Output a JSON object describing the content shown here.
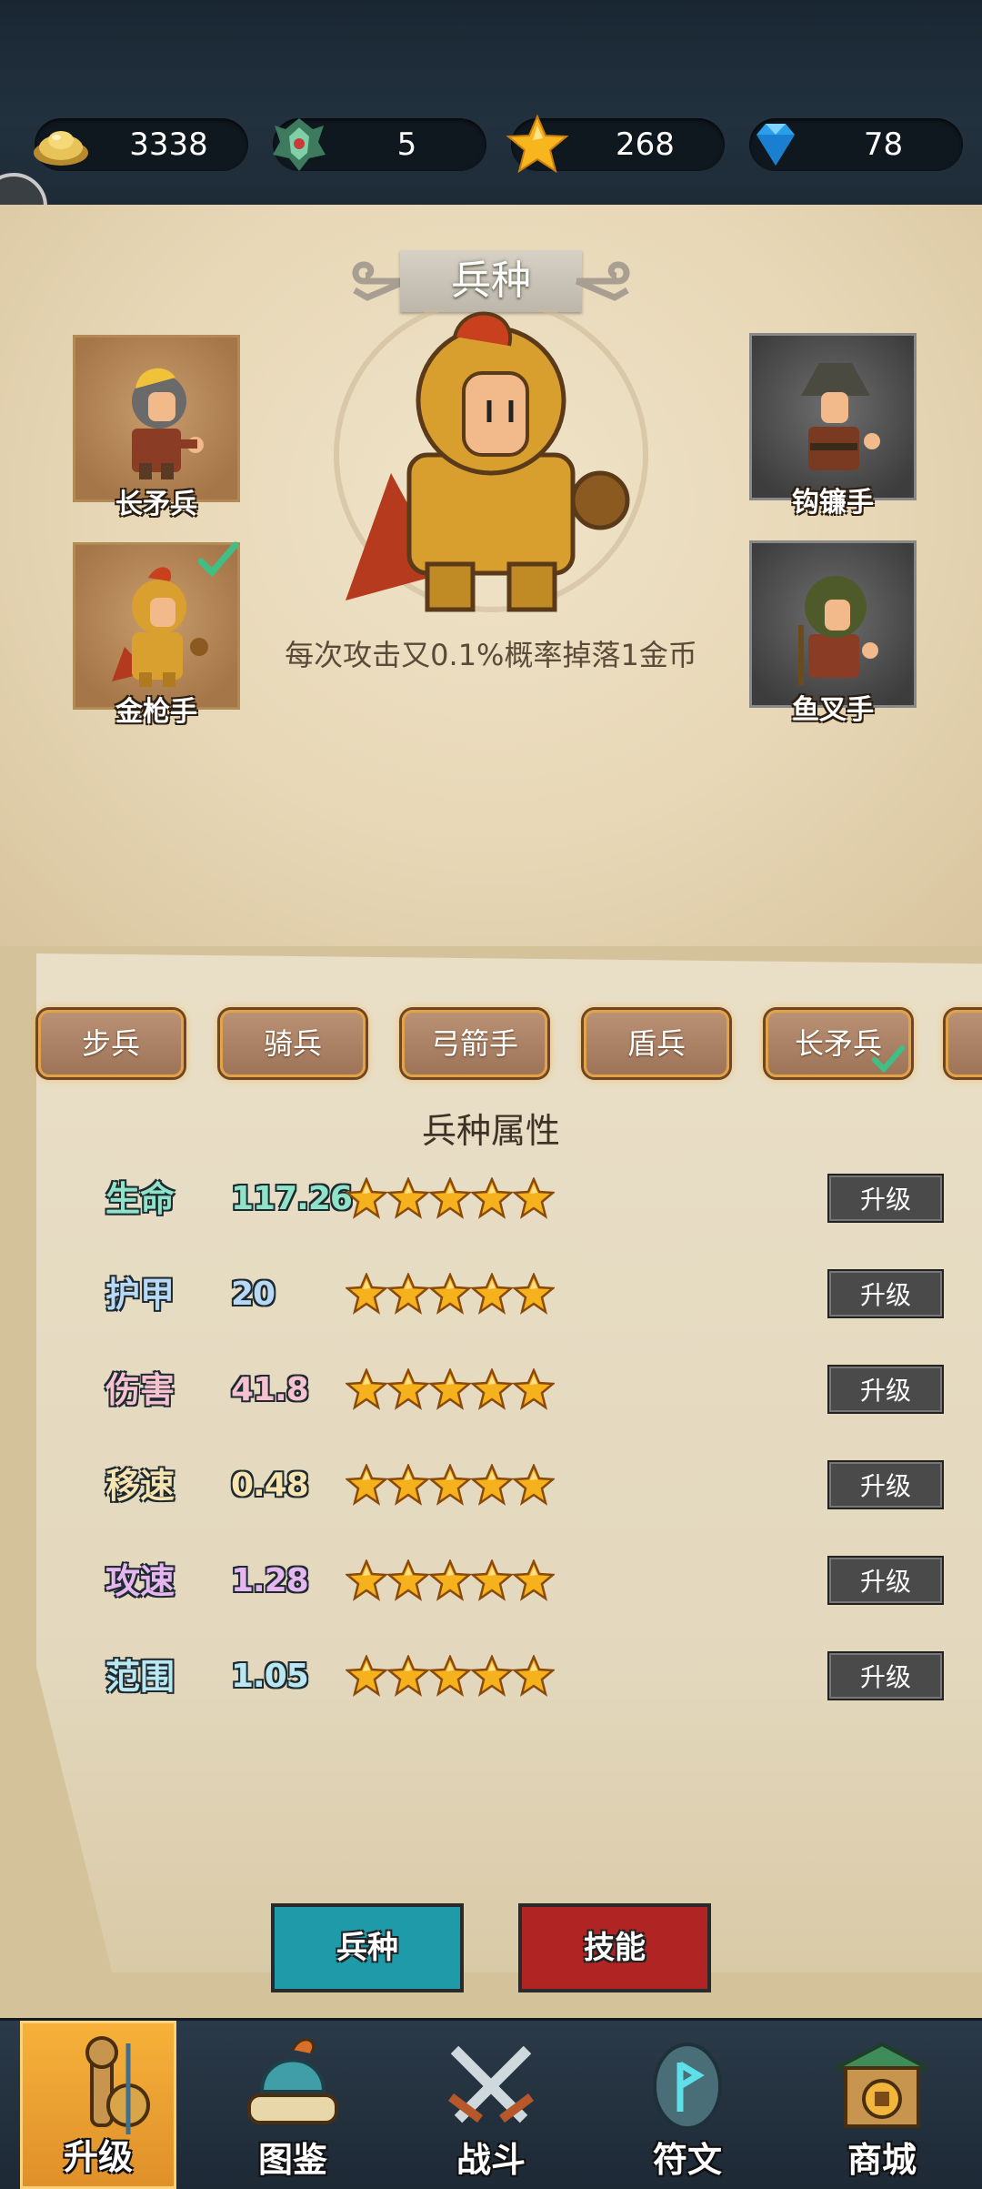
{
  "resources": [
    {
      "icon": "gold-ingot-icon",
      "value": "3338"
    },
    {
      "icon": "dragon-emblem-icon",
      "value": "5"
    },
    {
      "icon": "star-icon",
      "value": "268"
    },
    {
      "icon": "diamond-icon",
      "value": "78"
    }
  ],
  "title": "兵种",
  "units_left": [
    {
      "label": "长矛兵",
      "selected": false
    },
    {
      "label": "金枪手",
      "selected": true
    }
  ],
  "units_right": [
    {
      "label": "钩镰手",
      "locked": true
    },
    {
      "label": "鱼叉手",
      "locked": true
    }
  ],
  "hero_description": "每次攻击又0.1%概率掉落1金币",
  "tabs": [
    {
      "label": "步兵"
    },
    {
      "label": "骑兵"
    },
    {
      "label": "弓箭手"
    },
    {
      "label": "盾兵"
    },
    {
      "label": "长矛兵",
      "selected": true
    }
  ],
  "section_title": "兵种属性",
  "attributes": [
    {
      "name": "生命",
      "value": "117.26",
      "stars": 5,
      "button": "升级",
      "color": "#8fe3c8"
    },
    {
      "name": "护甲",
      "value": "20",
      "stars": 5,
      "button": "升级",
      "color": "#b8d9f5"
    },
    {
      "name": "伤害",
      "value": "41.8",
      "stars": 5,
      "button": "升级",
      "color": "#f7c2cf"
    },
    {
      "name": "移速",
      "value": "0.48",
      "stars": 5,
      "button": "升级",
      "color": "#f7e4b0"
    },
    {
      "name": "攻速",
      "value": "1.28",
      "stars": 5,
      "button": "升级",
      "color": "#e6b6f0"
    },
    {
      "name": "范围",
      "value": "1.05",
      "stars": 5,
      "button": "升级",
      "color": "#b9e8f2"
    }
  ],
  "bottom_buttons": {
    "unit": "兵种",
    "skill": "技能"
  },
  "nav": [
    {
      "label": "升级",
      "icon": "training-dummy-icon",
      "active": true
    },
    {
      "label": "图鉴",
      "icon": "helmet-scroll-icon",
      "active": false
    },
    {
      "label": "战斗",
      "icon": "crossed-swords-icon",
      "active": false
    },
    {
      "label": "符文",
      "icon": "rune-stone-icon",
      "active": false
    },
    {
      "label": "商城",
      "icon": "shop-gate-icon",
      "active": false
    }
  ]
}
